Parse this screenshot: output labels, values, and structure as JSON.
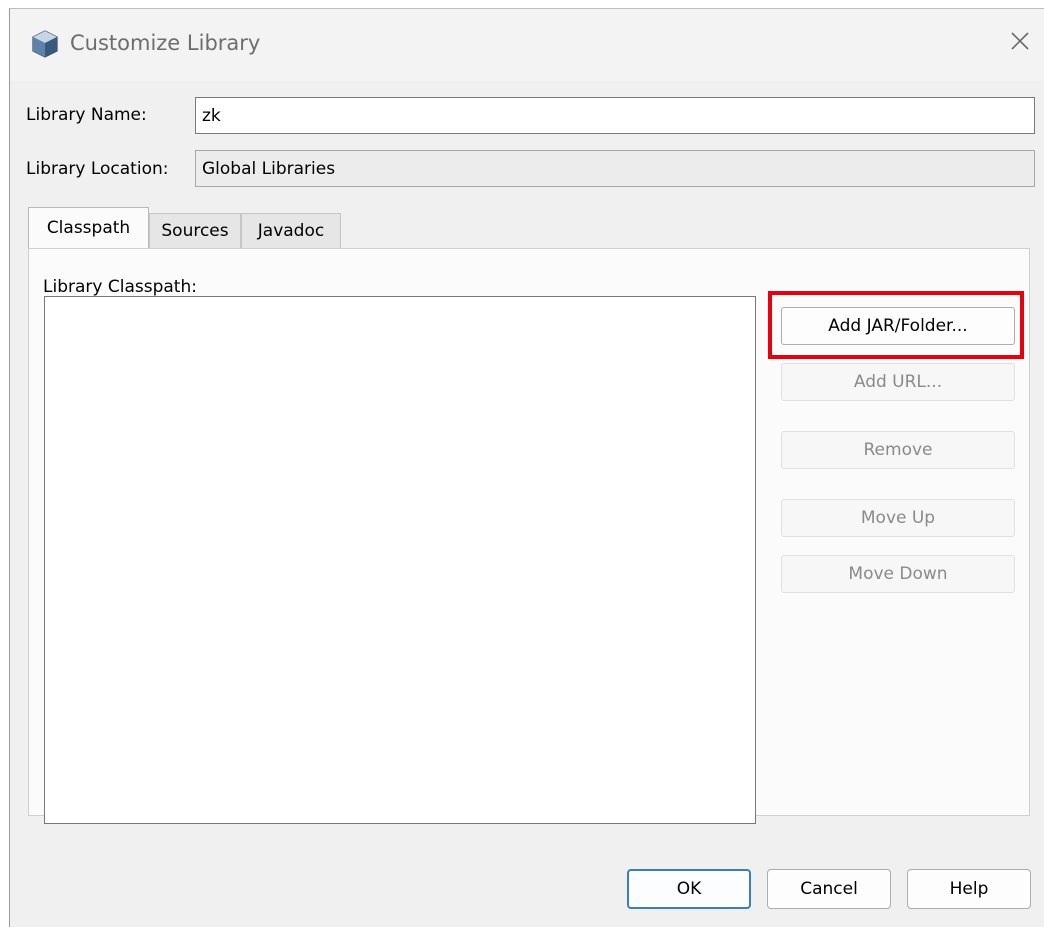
{
  "dialog": {
    "title": "Customize Library",
    "icon": "cube-icon",
    "close_icon": "close-icon"
  },
  "form": {
    "library_name_label": "Library Name:",
    "library_name_value": "zk",
    "library_location_label": "Library Location:",
    "library_location_value": "Global Libraries"
  },
  "tabs": [
    {
      "label": "Classpath",
      "selected": true
    },
    {
      "label": "Sources",
      "selected": false
    },
    {
      "label": "Javadoc",
      "selected": false
    }
  ],
  "classpath": {
    "list_label": "Library Classpath:",
    "items": []
  },
  "side_buttons": [
    {
      "label": "Add JAR/Folder...",
      "enabled": true
    },
    {
      "label": "Add URL...",
      "enabled": false
    },
    {
      "label": "Remove",
      "enabled": false
    },
    {
      "label": "Move Up",
      "enabled": false
    },
    {
      "label": "Move Down",
      "enabled": false
    }
  ],
  "footer": {
    "ok_label": "OK",
    "cancel_label": "Cancel",
    "help_label": "Help"
  },
  "colors": {
    "highlight": "#e8000d",
    "default_button_border": "#3c7fb1"
  }
}
